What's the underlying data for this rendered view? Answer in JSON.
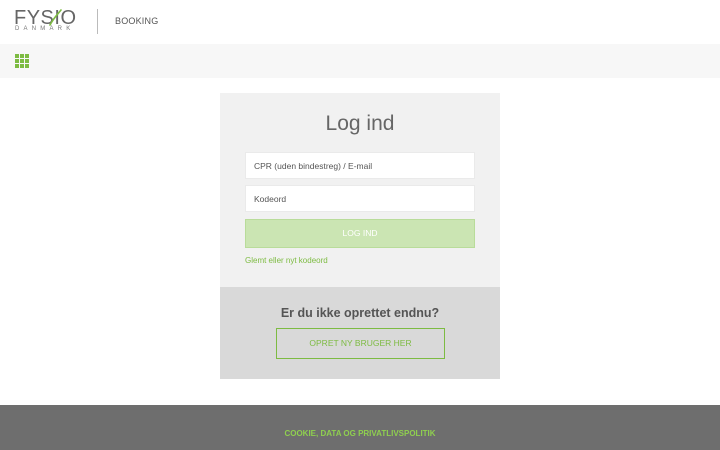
{
  "header": {
    "logo": {
      "word": "FYSIO",
      "sub": "DANMARK"
    },
    "nav_label": "BOOKING"
  },
  "toolbar": {
    "icon": "apps-grid-icon"
  },
  "login": {
    "title": "Log ind",
    "id_placeholder": "CPR (uden bindestreg) / E-mail",
    "password_placeholder": "Kodeord",
    "submit_label": "LOG IND",
    "forgot_label": "Glemt eller nyt kodeord"
  },
  "signup": {
    "title": "Er du ikke oprettet endnu?",
    "button_label": "OPRET NY BRUGER HER"
  },
  "footer": {
    "link_label": "COOKIE, DATA OG PRIVATLIVSPOLITIK"
  },
  "colors": {
    "accent": "#7dbb42",
    "button_disabled_bg": "#cbe5b3",
    "card_bg": "#f1f1f1",
    "card_bottom_bg": "#d9d9d9",
    "footer_bg": "#6e6e6e"
  }
}
